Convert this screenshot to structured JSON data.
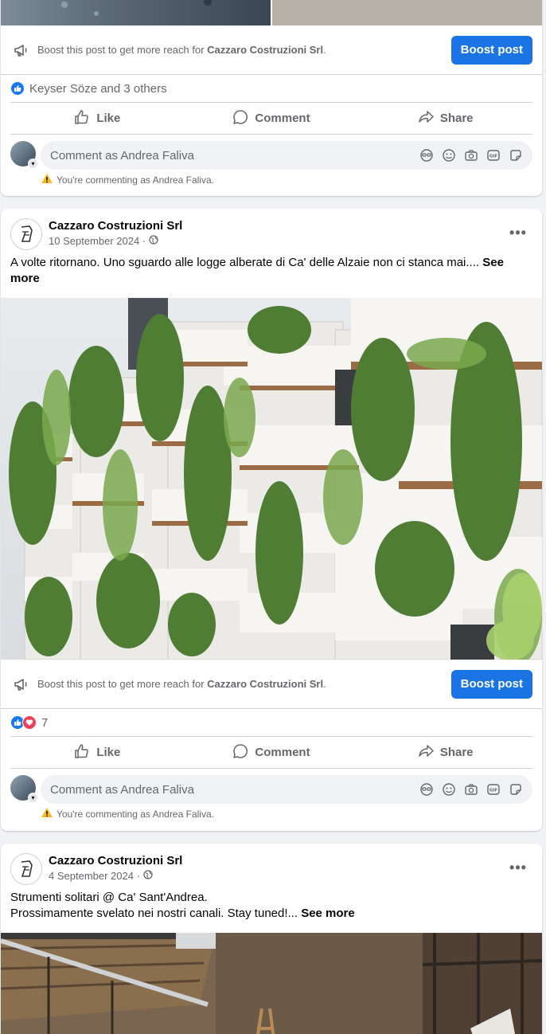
{
  "post1": {
    "boost_text_prefix": "Boost this post to get more reach for ",
    "boost_page_name": "Cazzaro Costruzioni Srl",
    "boost_text_suffix": ".",
    "boost_button": "Boost post",
    "reactions_text": "Keyser Söze and 3 others",
    "actions": {
      "like": "Like",
      "comment": "Comment",
      "share": "Share"
    },
    "comment_placeholder": "Comment as Andrea Faliva",
    "commenting_as": "You're commenting as Andrea Faliva."
  },
  "post2": {
    "page_name": "Cazzaro Costruzioni Srl",
    "date": "10 September 2024 ·",
    "text": "A volte ritornano. Uno sguardo alle logge alberate di Ca' delle Alzaie non ci stanca mai.... ",
    "see_more": "See more",
    "boost_text_prefix": "Boost this post to get more reach for ",
    "boost_page_name": "Cazzaro Costruzioni Srl",
    "boost_text_suffix": ".",
    "boost_button": "Boost post",
    "reactions_count": "7",
    "actions": {
      "like": "Like",
      "comment": "Comment",
      "share": "Share"
    },
    "comment_placeholder": "Comment as Andrea Faliva",
    "commenting_as": "You're commenting as Andrea Faliva."
  },
  "post3": {
    "page_name": "Cazzaro Costruzioni Srl",
    "date": "4 September 2024 ·",
    "text_line1": "Strumenti solitari @ Ca' Sant'Andrea.",
    "text_line2": "Prossimamente svelato nei nostri canali. Stay tuned!... ",
    "see_more": "See more"
  },
  "colors": {
    "brand_blue": "#1b74e4",
    "like_blue": "#1877f2",
    "love_red": "#f33e58",
    "secondary_text": "#65676b",
    "background": "#f0f2f5"
  },
  "icons": [
    "megaphone-icon",
    "like-reaction-icon",
    "love-reaction-icon",
    "thumbs-up-icon",
    "comment-bubble-icon",
    "share-arrow-icon",
    "avatar-sticker-icon",
    "emoji-icon",
    "camera-icon",
    "gif-icon",
    "sticker-icon",
    "warning-icon",
    "globe-icon",
    "more-options-icon"
  ]
}
